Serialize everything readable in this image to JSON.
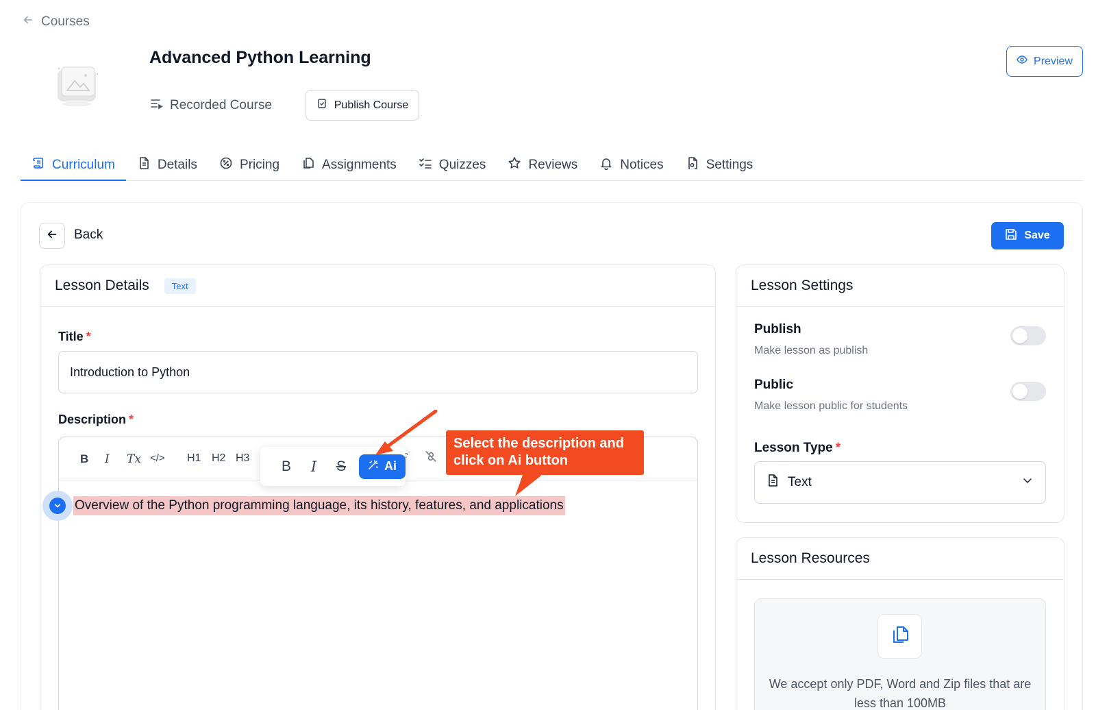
{
  "breadcrumb": {
    "label": "Courses"
  },
  "course": {
    "title": "Advanced Python Learning",
    "type": "Recorded Course",
    "publish_label": "Publish Course",
    "preview_label": "Preview"
  },
  "tabs": [
    {
      "label": "Curriculum",
      "icon": "scroll-icon",
      "active": true
    },
    {
      "label": "Details",
      "icon": "document-icon"
    },
    {
      "label": "Pricing",
      "icon": "discount-badge-icon"
    },
    {
      "label": "Assignments",
      "icon": "copy-documents-icon"
    },
    {
      "label": "Quizzes",
      "icon": "checklist-icon"
    },
    {
      "label": "Reviews",
      "icon": "star-icon"
    },
    {
      "label": "Notices",
      "icon": "bell-icon"
    },
    {
      "label": "Settings",
      "icon": "file-gear-icon"
    }
  ],
  "actions": {
    "back_label": "Back",
    "save_label": "Save"
  },
  "lesson_details": {
    "heading": "Lesson Details",
    "badge": "Text",
    "title_label": "Title",
    "title_value": "Introduction to Python",
    "description_label": "Description",
    "description_value": "Overview of the Python programming language, its history, features, and applications",
    "toolbar": [
      "B",
      "I",
      "Tx",
      "</>",
      "H1",
      "H2",
      "H3"
    ],
    "bubble": {
      "bold": "B",
      "italic": "I",
      "strike": "S",
      "ai": "Ai"
    }
  },
  "callout": {
    "text": "Select the description and click on Ai button"
  },
  "lesson_settings": {
    "heading": "Lesson Settings",
    "publish_title": "Publish",
    "publish_sub": "Make lesson as publish",
    "publish_on": false,
    "public_title": "Public",
    "public_sub": "Make lesson public for students",
    "public_on": false,
    "type_label": "Lesson Type",
    "type_value": "Text"
  },
  "lesson_resources": {
    "heading": "Lesson Resources",
    "drop_text": "We accept only PDF, Word and Zip files that are less than 100MB"
  },
  "colors": {
    "accent": "#1d6ff2",
    "callout": "#f24a21",
    "highlight": "#f5c6c6"
  }
}
